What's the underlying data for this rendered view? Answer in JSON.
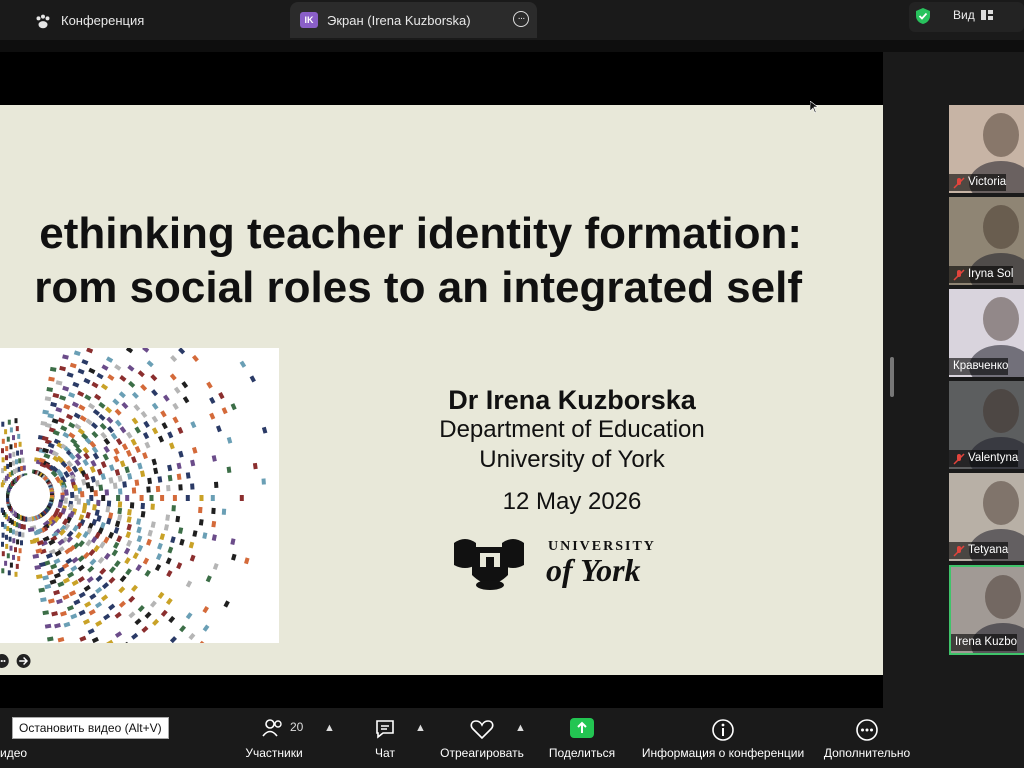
{
  "topbar": {
    "conference_tab": "Конференция",
    "screen_tab_badge": "IK",
    "screen_tab": "Экран (Irena Kuzborska)",
    "view_label": "Вид"
  },
  "slide": {
    "title_line1": "ethinking teacher identity formation:",
    "title_line2": "rom social roles to an integrated self",
    "author": "Dr Irena Kuzborska",
    "department": "Department of Education",
    "university": "University of York",
    "date": "12 May 2026",
    "logo_text_1": "UNIVERSITY",
    "logo_text_2": "of York"
  },
  "participants": [
    {
      "name": "Victoria ",
      "tone": "#c7b4a5",
      "muted": true
    },
    {
      "name": "Iryna Sol",
      "tone": "#8f8574",
      "muted": true
    },
    {
      "name": "Кравченко",
      "tone": "#d9d4dd",
      "muted": false
    },
    {
      "name": "Valentyna",
      "tone": "#5c5e5f",
      "muted": true
    },
    {
      "name": "Tetyana ",
      "tone": "#b8b0a6",
      "muted": true
    },
    {
      "name": "Irena Kuzbo",
      "tone": "#a19a95",
      "muted": false
    }
  ],
  "toolbar": {
    "participants_label": "Участники",
    "participants_count": "20",
    "chat_label": "Чат",
    "react_label": "Отреагировать",
    "share_label": "Поделиться",
    "info_label": "Информация о конференции",
    "more_label": "Дополнительно",
    "video_label": "идео",
    "stop_video_tooltip": "Остановить видео (Alt+V)"
  },
  "colors": {
    "slide_bg": "#e8e8d9",
    "share_green": "#23c552",
    "active_border": "#3fc46a",
    "shield_green": "#28c25d"
  }
}
